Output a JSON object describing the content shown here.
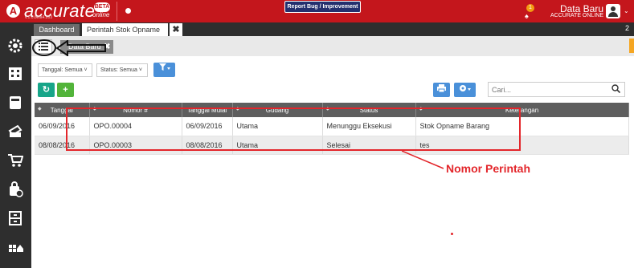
{
  "app": {
    "logo_letter": "A",
    "logo_text": "accurate",
    "logo_beta": "BETA",
    "logo_online": "online",
    "version": "v.1.0.beta4.203",
    "report_label": "Report Bug / Improvement",
    "notif_count": "1",
    "user_name": "Data Baru",
    "user_sub": "ACCURATE ONLINE"
  },
  "tabs": {
    "dashboard": "Dashboard",
    "active": "Perintah Stok Opname",
    "close": "✖",
    "count": "2"
  },
  "subtab": {
    "label": "Data Baru",
    "close": "✖"
  },
  "filters": {
    "tanggal": "Tanggal: Semua",
    "status": "Status: Semua"
  },
  "search": {
    "placeholder": "Cari..."
  },
  "table": {
    "columns": [
      "Tanggal",
      "Nomor #",
      "Tanggal Mulai",
      "Gudang",
      "Status",
      "Keterangan"
    ],
    "rows": [
      [
        "06/09/2016",
        "OPO.00004",
        "06/09/2016",
        "Utama",
        "Menunggu Eksekusi",
        "Stok Opname Barang"
      ],
      [
        "08/08/2016",
        "OPO.00003",
        "08/08/2016",
        "Utama",
        "Selesai",
        "tes"
      ]
    ]
  },
  "annotation": {
    "label": "Nomor Perintah"
  },
  "colors": {
    "brand": "#c4161c",
    "sidebar": "#2e2e2e",
    "accent_teal": "#17a589",
    "accent_green": "#52b43a",
    "accent_blue": "#4a90d9",
    "annotation": "#e3262b"
  },
  "icons": [
    "gear-icon",
    "dashboard-icon",
    "ledger-icon",
    "card-icon",
    "cart-icon",
    "bag-icon",
    "cabinet-icon",
    "more-icon",
    "refresh-icon",
    "plus-icon",
    "filter-icon",
    "print-icon",
    "settings-icon",
    "search-icon",
    "bulb-icon",
    "bell-icon",
    "user-icon",
    "list-icon"
  ]
}
